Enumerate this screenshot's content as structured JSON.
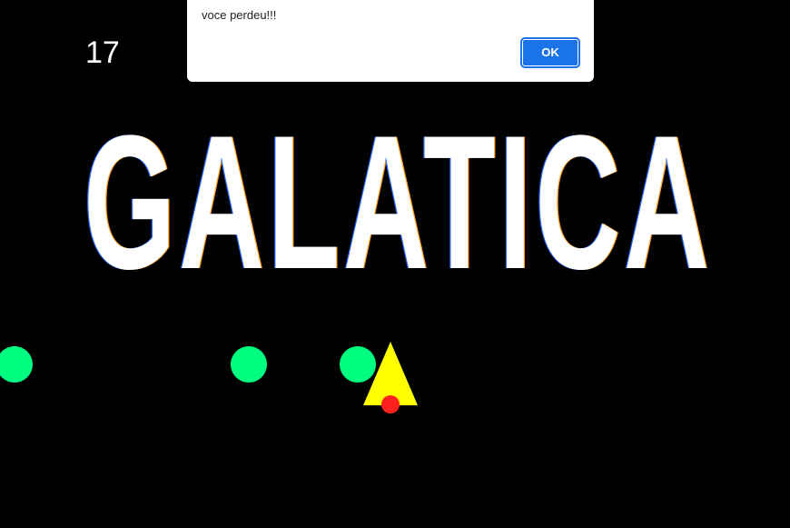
{
  "game": {
    "score": "17",
    "title": "GALATICA"
  },
  "alert": {
    "message": "voce perdeu!!!",
    "ok_label": "OK"
  },
  "colors": {
    "background": "#000000",
    "enemy": "#00ff80",
    "ship": "#ffff00",
    "shot": "#ff2020",
    "button": "#1a73e8"
  },
  "sprites": {
    "enemies": [
      "enemy-circle",
      "enemy-circle",
      "enemy-circle"
    ],
    "player": "ship-triangle",
    "projectile": "shot-dot"
  }
}
